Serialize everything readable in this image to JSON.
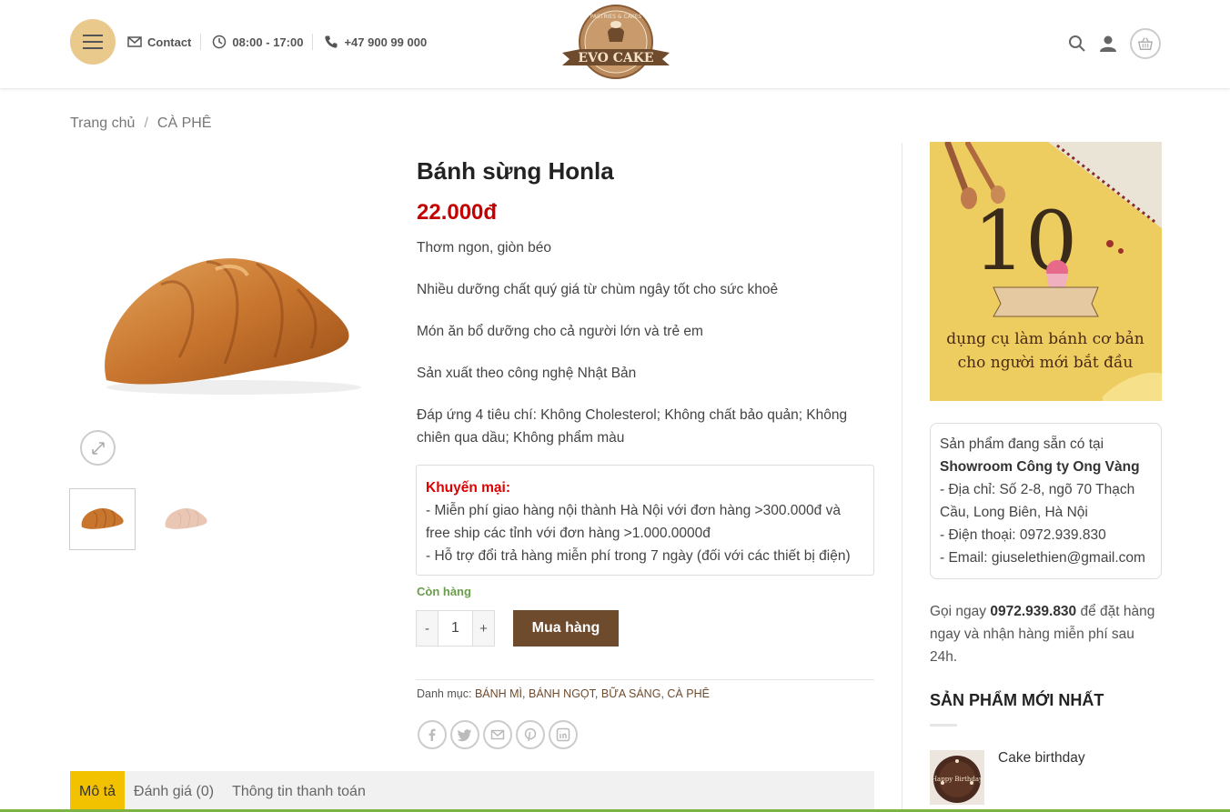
{
  "header": {
    "contact_label": "Contact",
    "hours": "08:00 - 17:00",
    "phone": "+47 900 99 000",
    "logo_text": "EVO CAKE",
    "logo_arc_text": "PASTRIES & CAKES"
  },
  "breadcrumb": {
    "home": "Trang chủ",
    "separator": "/",
    "current": "CÀ PHÊ"
  },
  "product": {
    "title": "Bánh sừng Honla",
    "price": "22.000đ",
    "description": [
      "Thơm ngon, giòn béo",
      "Nhiều dưỡng chất quý giá từ chùm ngây tốt cho sức khoẻ",
      "Món ăn bổ dưỡng cho cả người lớn và trẻ em",
      "Sản xuất theo công nghệ Nhật Bản",
      "Đáp ứng 4 tiêu chí: Không Cholesterol; Không chất bảo quản; Không chiên qua dầu; Không phẩm màu"
    ],
    "promo_title": "Khuyến mại:",
    "promo_line1": "- Miễn phí giao hàng nội thành Hà Nội với đơn hàng >300.000đ và free ship các tỉnh với đơn hàng >1.000.0000đ",
    "promo_line2": "- Hỗ trợ đổi trả hàng miễn phí trong 7 ngày (đối với các thiết bị điện)",
    "stock": "Còn hàng",
    "qty_minus": "-",
    "qty_value": "1",
    "qty_plus": "+",
    "buy_label": "Mua hàng",
    "categories_label": "Danh mục:",
    "categories": [
      "BÁNH MÌ",
      "BÁNH NGỌT",
      "BỮA SÁNG",
      "CÀ PHÊ"
    ]
  },
  "tabs": [
    "Mô tả",
    "Đánh giá (0)",
    "Thông tin thanh toán"
  ],
  "sidebar": {
    "banner": {
      "number": "10",
      "line1": "dụng cụ làm bánh cơ bản",
      "line2": "cho người mới bắt đầu"
    },
    "showroom_intro": "Sản phẩm đang sẵn có tại",
    "showroom_name": "Showroom Công ty Ong Vàng",
    "showroom_address": "- Địa chỉ: Số 2-8, ngõ 70 Thạch Cầu, Long Biên, Hà Nội",
    "showroom_phone": "- Điện thoại: 0972.939.830",
    "showroom_email": "- Email: giuselethien@gmail.com",
    "call_prefix": "Gọi ngay",
    "call_number": "0972.939.830",
    "call_suffix": "để đặt hàng ngay và nhận hàng miễn phí sau 24h.",
    "newest_title": "SẢN PHẨM MỚI NHẤT",
    "newest_item": "Cake birthday",
    "newest_item_caption": "Happy Birthday"
  },
  "colors": {
    "accent_gold": "#e9c98c",
    "price_red": "#c40000",
    "buy_brown": "#6f4b2d",
    "tab_active": "#f2c200",
    "stock_green": "#6a9f4a"
  }
}
